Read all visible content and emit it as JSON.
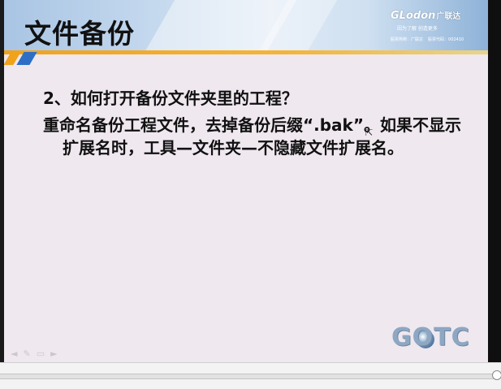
{
  "slide": {
    "title": "文件备份",
    "brand_logo": "GLodon",
    "brand_cn": "广联达",
    "brand_slogan": "因为了解 创造更多",
    "stock_name": "股票简称：广联达",
    "stock_code": "股票代码：002410",
    "question": "2、如何打开备份文件夹里的工程？",
    "answer": "重命名备份工程文件，去掉备份后缀“.bak”。如果不显示扩展名时，工具—文件夹—不隐藏文件扩展名。",
    "footer_logo": "GOTC"
  },
  "icons": [
    "mouse-cursor-icon",
    "prev-slide-icon",
    "pen-icon",
    "menu-icon",
    "next-slide-icon",
    "globe-icon"
  ],
  "player": {
    "progress": 1.0
  }
}
